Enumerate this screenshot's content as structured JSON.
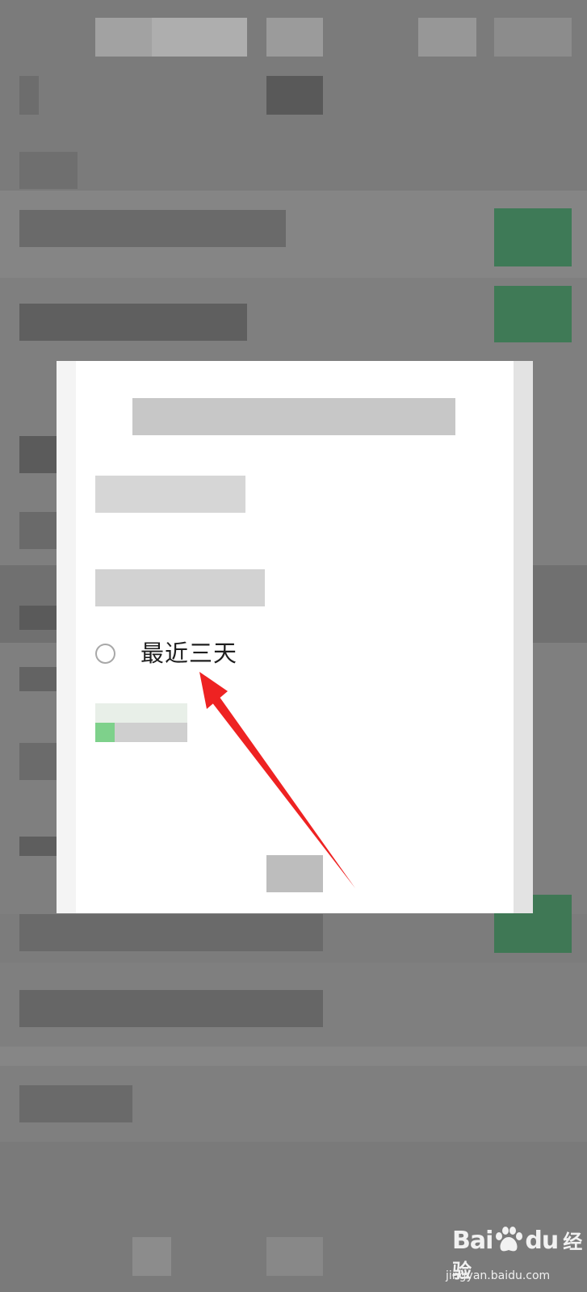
{
  "dialog": {
    "options": [
      {
        "label": "",
        "selected": false,
        "obscured": true
      },
      {
        "label": "",
        "selected": false,
        "obscured": true
      },
      {
        "label": "最近三天",
        "selected": false,
        "obscured": false
      },
      {
        "label": "",
        "selected": true,
        "obscured": true
      }
    ]
  },
  "watermark": {
    "brand_bai": "Bai",
    "brand_du": "du",
    "brand_cn": "经验",
    "site": "jingyan.baidu.com"
  },
  "colors": {
    "overlay": "#7f7f7f",
    "dialog_bg": "#ffffff",
    "arrow": "#ee2222",
    "accent_green": "#07c160"
  }
}
